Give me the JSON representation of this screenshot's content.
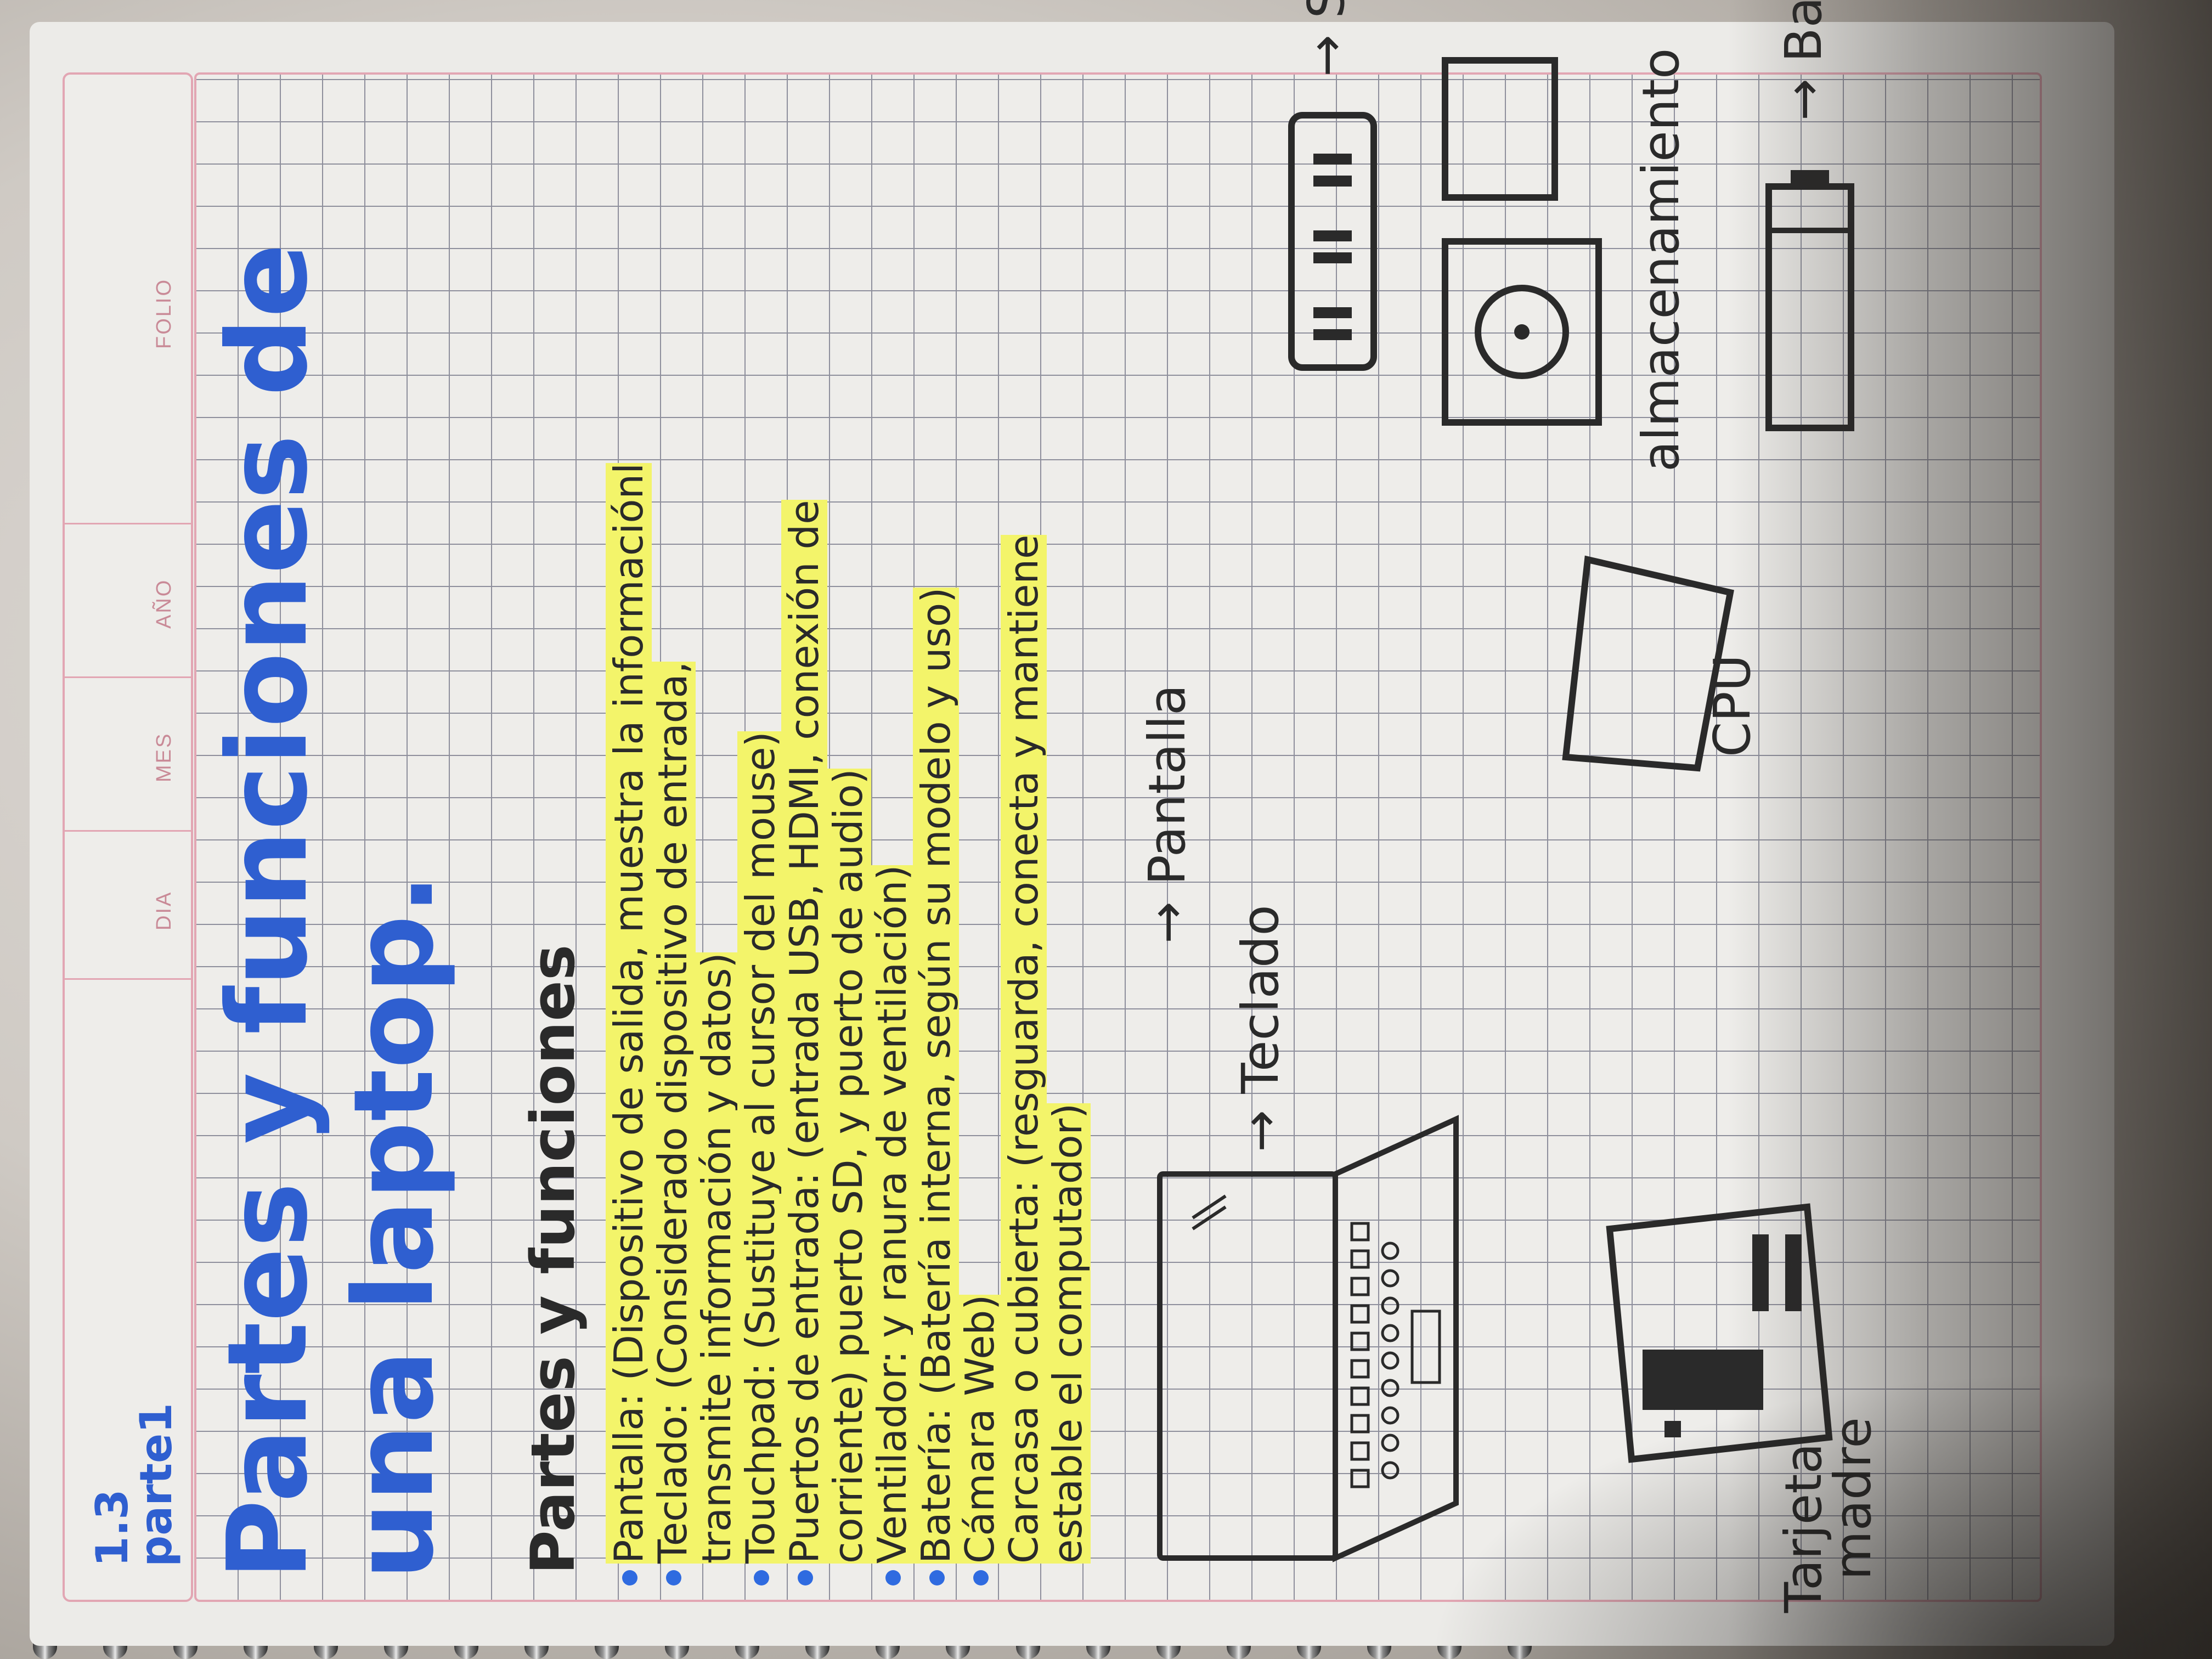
{
  "header": {
    "labels": [
      "DIA",
      "MES",
      "AÑO",
      "FOLIO"
    ],
    "number": "1.3",
    "subtitle": "parte1"
  },
  "title": {
    "line1": "Partes y funciones de",
    "line2": "una laptop."
  },
  "section_heading": "Partes y funciones",
  "notes": [
    "Pantalla: (Dispositivo de salida, muestra la informaciónl",
    "Teclado: (Considerado dispositivo de entrada,",
    "transmite información y datos)",
    "Touchpad: (Sustituye al cursor del mouse)",
    "Puertos de entrada: (entrada USB, HDMI, conexión de",
    "corriente) puerto SD, y puerto de audio)",
    "Ventilador: y ranura de ventilación)",
    "Batería: (Batería interna, según su modelo y uso)",
    "Cámara Web)",
    "Carcasa o cubierta: (resguarda, conecta y mantiene",
    "estable el computador)"
  ],
  "diagram_labels": {
    "pantalla": "Pantalla",
    "teclado": "Teclado",
    "cpu": "CPU",
    "sdram": "SDRAM",
    "almacenamiento": "almacenamiento",
    "bateria": "Batería",
    "tarjeta_line1": "Tarjeta",
    "tarjeta_line2": "madre"
  }
}
